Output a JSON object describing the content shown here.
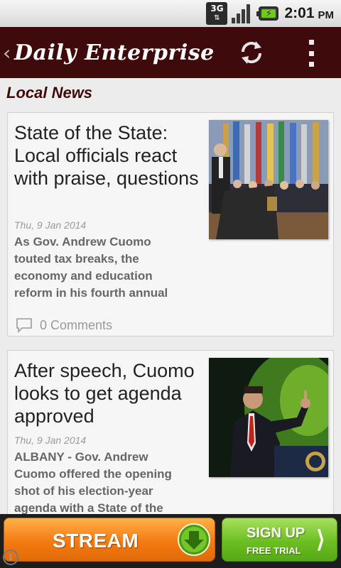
{
  "status_bar": {
    "network": "3G",
    "network_arrows": "⇅",
    "time": "2:01",
    "ampm": "PM",
    "battery_color": "#6ecb1d"
  },
  "header": {
    "back_icon": "‹",
    "title": "Daily Enterprise",
    "background": "#3f0a0b",
    "actions": [
      "refresh-icon",
      "overflow-menu-icon"
    ]
  },
  "section": {
    "title": "Local News"
  },
  "articles": [
    {
      "headline": "State of the State: Local officials react with praise, questions",
      "date": "Thu, 9 Jan 2014",
      "summary": "As Gov. Andrew Cuomo touted tax breaks, the economy and education reform in his fourth annual",
      "comments": "0 Comments"
    },
    {
      "headline": "After speech, Cuomo looks to get agenda approved",
      "date": "Thu, 9 Jan 2014",
      "summary": "ALBANY - Gov. Andrew Cuomo offered the opening shot of his election-year agenda with a State of the"
    }
  ],
  "ad": {
    "stream_label": "STREAM",
    "signup_label": "SIGN UP",
    "signup_sub": "FREE TRIAL",
    "stream_color": "#f47b12",
    "signup_color": "#6bbf22"
  }
}
